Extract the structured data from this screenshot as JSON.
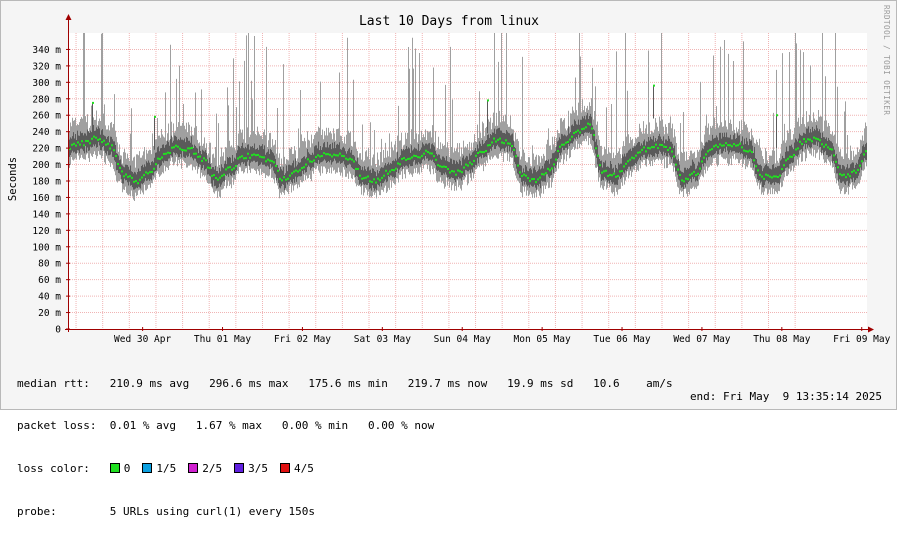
{
  "chart_data": {
    "type": "line",
    "title": "Last 10 Days from linux",
    "ylabel": "Seconds",
    "watermark": "RRDTOOL / TOBI OETIKER",
    "ylim": [
      0,
      0.36
    ],
    "yticks": [
      0,
      0.02,
      0.04,
      0.06,
      0.08,
      0.1,
      0.12,
      0.14,
      0.16,
      0.18,
      0.2,
      0.22,
      0.24,
      0.26,
      0.28,
      0.3,
      0.32,
      0.34
    ],
    "ytick_labels": [
      "0",
      "20 m",
      "40 m",
      "60 m",
      "80 m",
      "100 m",
      "120 m",
      "140 m",
      "160 m",
      "180 m",
      "200 m",
      "220 m",
      "240 m",
      "260 m",
      "280 m",
      "300 m",
      "320 m",
      "340 m"
    ],
    "xlim": [
      "2025-04-29T13:35",
      "2025-05-09T13:35"
    ],
    "xticks": [
      "2025-04-30T12:00",
      "2025-05-01T12:00",
      "2025-05-02T12:00",
      "2025-05-03T12:00",
      "2025-05-04T12:00",
      "2025-05-05T12:00",
      "2025-05-06T12:00",
      "2025-05-07T12:00",
      "2025-05-08T12:00",
      "2025-05-09T12:00"
    ],
    "xtick_labels": [
      "Wed 30 Apr",
      "Thu 01 May",
      "Fri 02 May",
      "Sat 03 May",
      "Sun 04 May",
      "Mon 05 May",
      "Tue 06 May",
      "Wed 07 May",
      "Thu 08 May",
      "Fri 09 May"
    ],
    "colors": {
      "background": "#f5f5f5",
      "canvas": "#ffffff",
      "grid": "#f0b4b4",
      "smoke_outer": "#a0a0a0",
      "smoke_inner": "#5a5a5a",
      "median": "#20e020",
      "axis": "#a00000"
    },
    "series": [
      {
        "name": "median rtt",
        "x": [
          "2025-04-29T14:00",
          "2025-04-29T18:00",
          "2025-04-29T22:00",
          "2025-04-30T02:00",
          "2025-04-30T06:00",
          "2025-04-30T10:00",
          "2025-04-30T14:00",
          "2025-04-30T18:00",
          "2025-04-30T22:00",
          "2025-05-01T02:00",
          "2025-05-01T06:00",
          "2025-05-01T10:00",
          "2025-05-01T14:00",
          "2025-05-01T18:00",
          "2025-05-01T22:00",
          "2025-05-02T02:00",
          "2025-05-02T06:00",
          "2025-05-02T10:00",
          "2025-05-02T14:00",
          "2025-05-02T18:00",
          "2025-05-02T22:00",
          "2025-05-03T02:00",
          "2025-05-03T06:00",
          "2025-05-03T10:00",
          "2025-05-03T14:00",
          "2025-05-03T18:00",
          "2025-05-03T22:00",
          "2025-05-04T02:00",
          "2025-05-04T06:00",
          "2025-05-04T10:00",
          "2025-05-04T14:00",
          "2025-05-04T18:00",
          "2025-05-04T22:00",
          "2025-05-05T02:00",
          "2025-05-05T06:00",
          "2025-05-05T10:00",
          "2025-05-05T14:00",
          "2025-05-05T18:00",
          "2025-05-05T22:00",
          "2025-05-06T02:00",
          "2025-05-06T06:00",
          "2025-05-06T10:00",
          "2025-05-06T14:00",
          "2025-05-06T18:00",
          "2025-05-06T22:00",
          "2025-05-07T02:00",
          "2025-05-07T06:00",
          "2025-05-07T10:00",
          "2025-05-07T14:00",
          "2025-05-07T18:00",
          "2025-05-07T22:00",
          "2025-05-08T02:00",
          "2025-05-08T06:00",
          "2025-05-08T10:00",
          "2025-05-08T14:00",
          "2025-05-08T18:00",
          "2025-05-08T22:00",
          "2025-05-09T02:00",
          "2025-05-09T06:00",
          "2025-05-09T10:00",
          "2025-05-09T13:00"
        ],
        "values": [
          0.222,
          0.226,
          0.232,
          0.222,
          0.188,
          0.178,
          0.192,
          0.212,
          0.222,
          0.218,
          0.205,
          0.182,
          0.195,
          0.21,
          0.212,
          0.205,
          0.182,
          0.19,
          0.205,
          0.212,
          0.212,
          0.205,
          0.185,
          0.18,
          0.192,
          0.205,
          0.21,
          0.215,
          0.195,
          0.19,
          0.2,
          0.218,
          0.23,
          0.228,
          0.185,
          0.18,
          0.195,
          0.225,
          0.24,
          0.25,
          0.19,
          0.186,
          0.205,
          0.218,
          0.222,
          0.22,
          0.182,
          0.19,
          0.218,
          0.225,
          0.225,
          0.215,
          0.185,
          0.185,
          0.208,
          0.228,
          0.232,
          0.22,
          0.185,
          0.19,
          0.215
        ]
      }
    ]
  },
  "stats": {
    "median_rtt_label": "median rtt:",
    "median_rtt_values": "210.9 ms avg   296.6 ms max   175.6 ms min   219.7 ms now   19.9 ms sd   10.6    am/s",
    "packet_loss_label": "packet loss:",
    "packet_loss_values": "0.01 % avg   1.67 % max   0.00 % min   0.00 % now",
    "loss_color_label": "loss color:",
    "loss_colors": [
      {
        "label": "0",
        "color": "#20e020"
      },
      {
        "label": "1/5",
        "color": "#0ca0e0"
      },
      {
        "label": "2/5",
        "color": "#d020d0"
      },
      {
        "label": "3/5",
        "color": "#6020e0"
      },
      {
        "label": "4/5",
        "color": "#e01010"
      }
    ],
    "probe_label": "probe:",
    "probe_value": "5 URLs using curl(1) every 150s",
    "end_label": "end: Fri May  9 13:35:14 2025"
  }
}
